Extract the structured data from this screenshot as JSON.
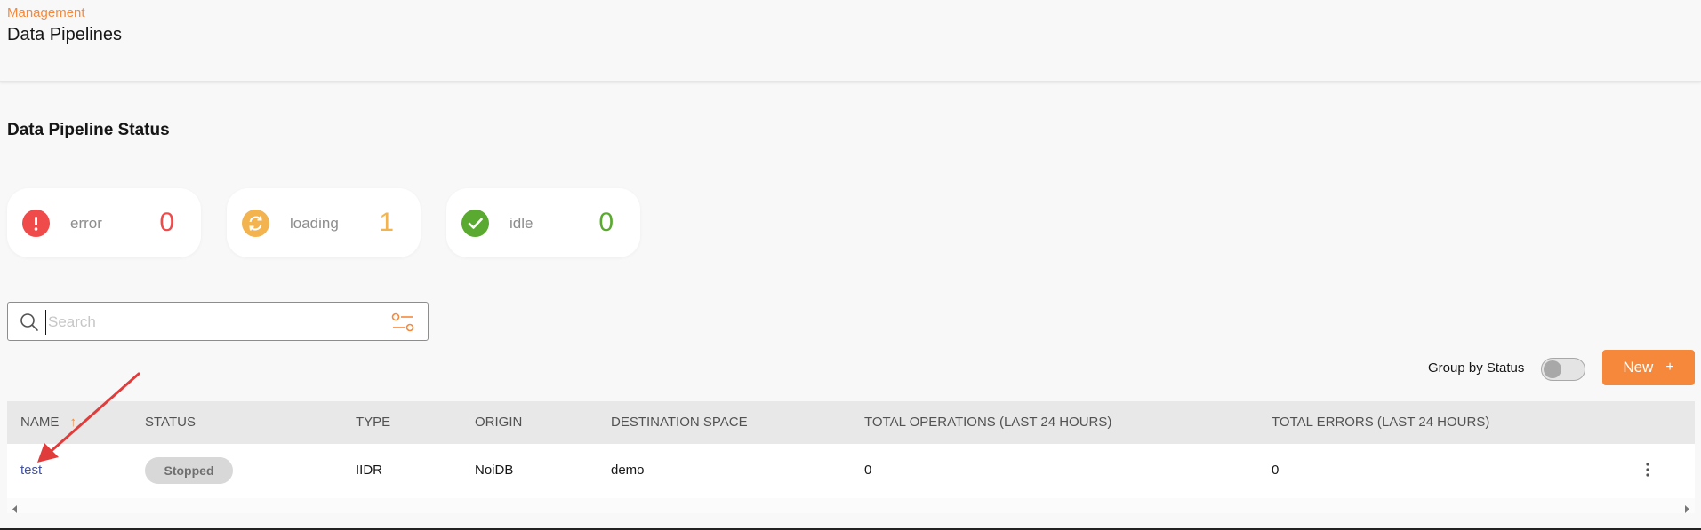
{
  "header": {
    "breadcrumb": "Management",
    "title": "Data Pipelines"
  },
  "status_section": {
    "title": "Data Pipeline Status",
    "cards": [
      {
        "label": "error",
        "count": "0",
        "color": "#ef4b4b",
        "icon": "exclamation-icon"
      },
      {
        "label": "loading",
        "count": "1",
        "color": "#f3b34e",
        "icon": "refresh-icon"
      },
      {
        "label": "idle",
        "count": "0",
        "color": "#5aa930",
        "icon": "check-icon"
      }
    ]
  },
  "search": {
    "placeholder": "Search",
    "value": ""
  },
  "toolbar": {
    "group_label": "Group by Status",
    "group_toggle_on": false,
    "new_label": "New",
    "new_icon": "+"
  },
  "table": {
    "columns": [
      "NAME",
      "STATUS",
      "TYPE",
      "ORIGIN",
      "DESTINATION SPACE",
      "TOTAL OPERATIONS (LAST 24 HOURS)",
      "TOTAL ERRORS (LAST 24 HOURS)"
    ],
    "sort_indicator": "↑",
    "rows": [
      {
        "name": "test",
        "status": "Stopped",
        "type": "IIDR",
        "origin": "NoiDB",
        "destination": "demo",
        "total_operations": "0",
        "total_errors": "0"
      }
    ]
  },
  "colors": {
    "accent": "#f5883a",
    "link": "#4353a0",
    "annotation_arrow": "#e03c3c"
  }
}
